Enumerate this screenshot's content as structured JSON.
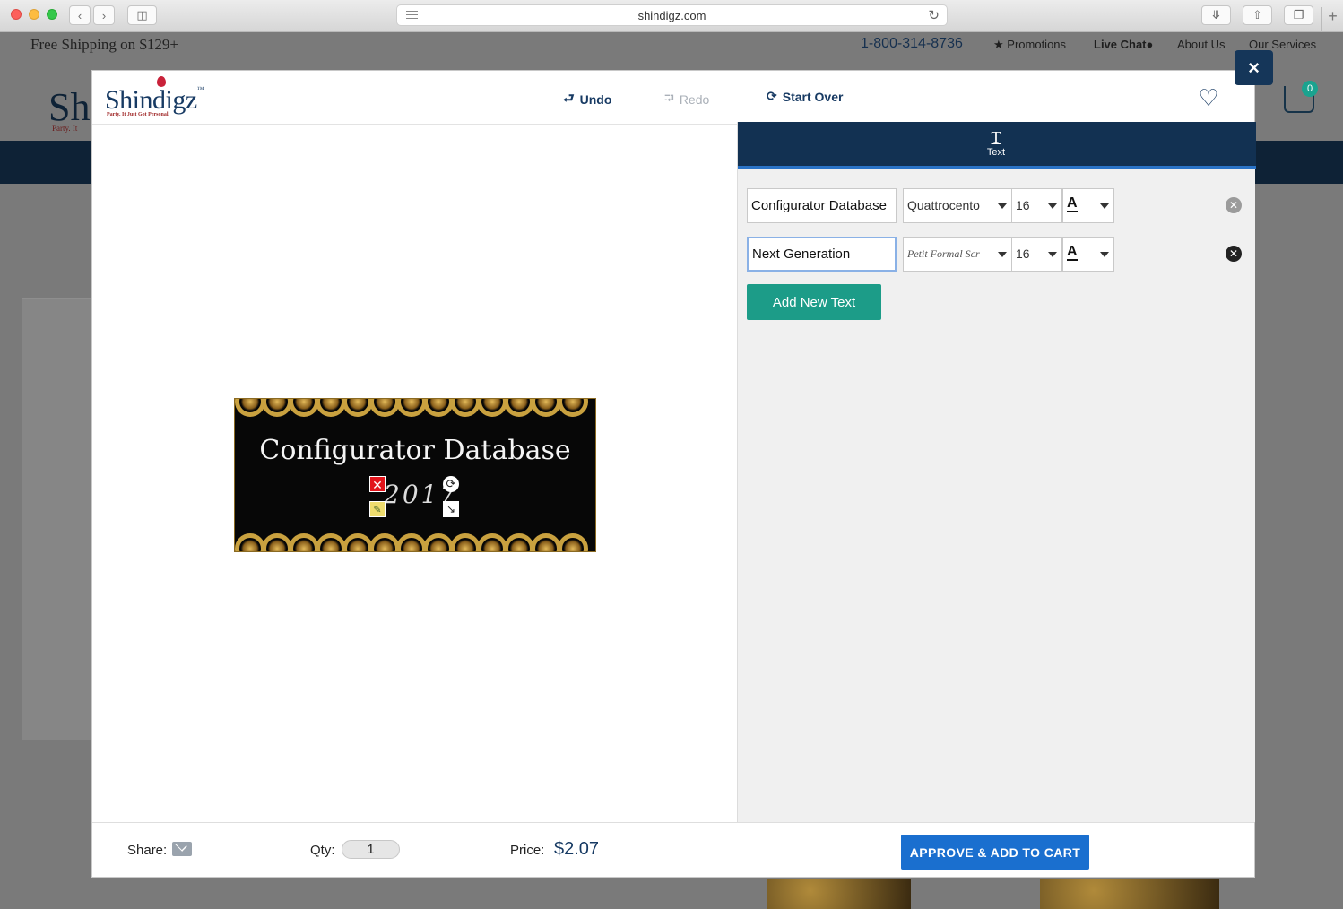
{
  "browser": {
    "url": "shindigz.com"
  },
  "site": {
    "free_shipping": "Free Shipping on $129+",
    "phone": "1-800-314-8736",
    "nav_links": [
      "Promotions",
      "Live Chat",
      "About Us",
      "Our Services"
    ],
    "cart_count": "0"
  },
  "modal": {
    "logo": {
      "name": "Shindigz",
      "tagline": "Party. It Just Got Personal."
    },
    "toolbar": {
      "undo": "Undo",
      "redo": "Redo",
      "start_over": "Start Over"
    },
    "close_label": "×",
    "tab": {
      "label": "Text",
      "icon_glyph": "T"
    },
    "text_rows": [
      {
        "text": "Configurator Database",
        "font": "Quattrocento",
        "size": "16"
      },
      {
        "text": "Next Generation",
        "font": "Petit Formal Scr",
        "size": "16"
      }
    ],
    "add_text_button": "Add New Text",
    "preview": {
      "title": "Configurator Database",
      "year": "2017"
    },
    "footer": {
      "share_label": "Share:",
      "qty_label": "Qty:",
      "qty_value": "1",
      "price_label": "Price:",
      "price_value": "$2.07",
      "approve_button": "APPROVE & ADD TO CART"
    }
  }
}
